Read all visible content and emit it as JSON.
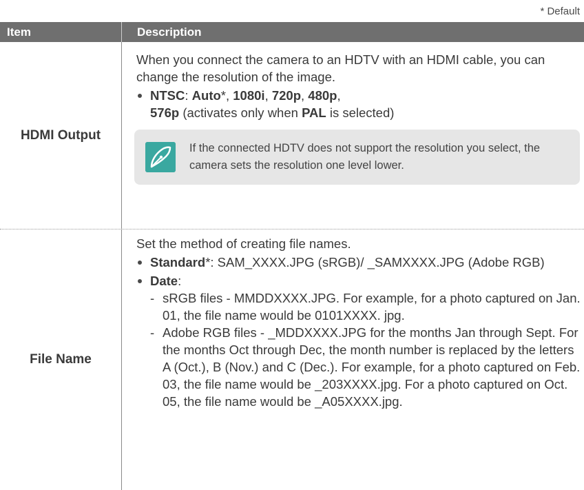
{
  "default_note": "* Default",
  "table": {
    "headers": [
      "Item",
      "Description"
    ],
    "hdmi": {
      "item": "HDMI Output",
      "intro": "When you connect the camera to an HDTV with an HDMI cable, you can change the resolution of the image.",
      "ntsc_label": "NTSC",
      "options": [
        "Auto",
        "1080i",
        "720p",
        "480p",
        "576p"
      ],
      "default_marker": "*",
      "pal_pre": "(activates only when",
      "pal_label": "PAL",
      "pal_post": "is selected)",
      "note": "If the connected HDTV does not support the resolution you select, the camera sets the resolution one level lower.",
      "note_icon": "pen-note-icon"
    },
    "filename": {
      "item": "File Name",
      "intro": "Set the method of creating file names.",
      "standard_label": "Standard",
      "standard_text": ": SAM_XXXX.JPG (sRGB)/ _SAMXXXX.JPG (Adobe RGB)",
      "date_label": "Date",
      "srgb_text": "sRGB files - MMDDXXXX.JPG. For example, for a photo captured on Jan. 01, the file name would be 0101XXXX. jpg.",
      "adobe_text": "Adobe RGB files - _MDDXXXX.JPG for the months Jan through Sept. For the months Oct through Dec, the month number is replaced by the letters A (Oct.), B (Nov.) and C (Dec.). For example, for a photo captured on Feb. 03, the file name would be _203XXXX.jpg. For a photo captured on Oct. 05, the file name would be _A05XXXX.jpg."
    }
  },
  "colors": {
    "header_bg": "#6f6f6f",
    "note_bg": "#e6e6e6",
    "icon_teal": "#3aa8a0"
  }
}
